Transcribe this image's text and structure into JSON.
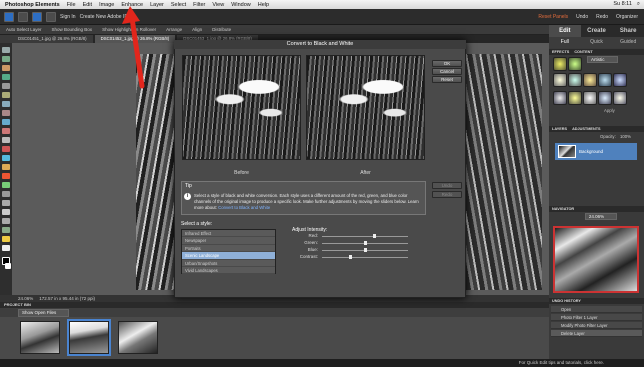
{
  "menubar": {
    "app": "Photoshop Elements",
    "items": [
      "File",
      "Edit",
      "Image",
      "Enhance",
      "Layer",
      "Select",
      "Filter",
      "View",
      "Window",
      "Help"
    ],
    "right": "Su 8:11"
  },
  "apptoolbar": {
    "signin": "Sign In",
    "create_id": "Create New Adobe ID",
    "reset_panels": "Reset Panels",
    "undo": "Undo",
    "redo": "Redo",
    "organizer": "Organizer"
  },
  "modetabs": [
    "Edit",
    "Create",
    "Share"
  ],
  "subtabs": [
    "Full",
    "Quick",
    "Guided"
  ],
  "optionsbar": [
    "Auto Select Layer",
    "Show Bounding Box",
    "Show Highlight on Rollover",
    "Arrange",
    "Align",
    "Distribute"
  ],
  "doctabs": [
    "DSC01451_1.jpg @ 26.8% (RGB/8)",
    "DSC01452_1.jpg @ 26.8% (RGB/8)",
    "DSC01453_1.jpg @ 26.8% (RGB/8)"
  ],
  "statusbar": {
    "zoom": "24.06%",
    "size": "172.57 in x 95.44 in (72 ppi)"
  },
  "projectbin": {
    "header": "PROJECT BIN",
    "show": "Show Open Files"
  },
  "taskbar": "For Quick Edit tips and tutorials, click here.",
  "panels": {
    "effects": "EFFECTS",
    "content": "CONTENT",
    "effects_select": "Artistic",
    "apply": "Apply",
    "layers": "LAYERS",
    "adjustments": "ADJUSTMENTS",
    "opacity": "Opacity:",
    "opacity_value": "100%",
    "layer_name": "Background",
    "navigator": "NAVIGATOR",
    "nav_zoom": "24.06%",
    "undo_history": "UNDO HISTORY",
    "history": [
      "Open",
      "Photo Filter 1 Layer",
      "Modify Photo Filter Layer",
      "Delete Layer"
    ]
  },
  "dialog": {
    "title": "Convert to Black and White",
    "before": "Before",
    "after": "After",
    "buttons": {
      "ok": "OK",
      "cancel": "Cancel",
      "reset": "Reset",
      "undo": "Undo",
      "redo": "Redo"
    },
    "tip_title": "Tip",
    "tip_text": "Select a style of black and white conversion. Each style uses a different amount of the red, green, and blue color channels of the original image to produce a specific look. Make further adjustments by moving the sliders below. Learn more about:",
    "tip_link": "Convert to Black and White",
    "style_label": "Select a style:",
    "styles": [
      "Infrared Effect",
      "Newspaper",
      "Portraits",
      "Scenic Landscape",
      "Urban/Snapshots",
      "Vivid Landscapes"
    ],
    "selected_style": 3,
    "intensity_label": "Adjust Intensity:",
    "sliders": [
      {
        "label": "Red:",
        "value": 0.6
      },
      {
        "label": "Green:",
        "value": 0.5
      },
      {
        "label": "Blue:",
        "value": 0.5
      },
      {
        "label": "Contrast:",
        "value": 0.33
      }
    ]
  },
  "colors": {
    "accent": "#4f81bd",
    "arrow": "#e2261c",
    "selection": "#8fb0d8"
  }
}
